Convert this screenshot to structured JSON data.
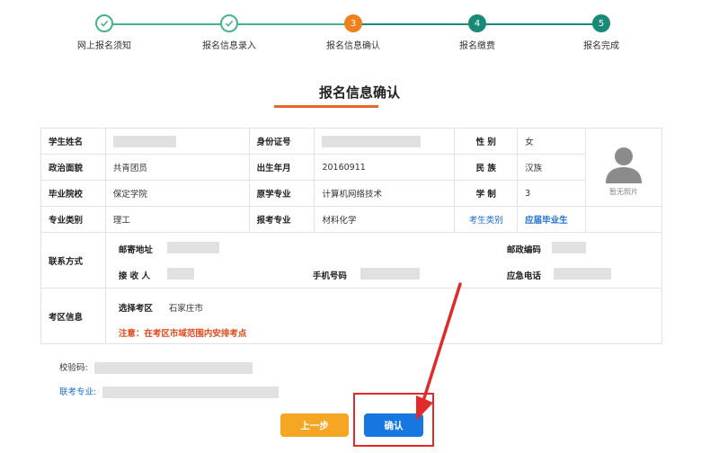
{
  "steps": [
    {
      "label": "网上报名须知",
      "state": "done",
      "number": ""
    },
    {
      "label": "报名信息录入",
      "state": "done",
      "number": ""
    },
    {
      "label": "报名信息确认",
      "state": "current",
      "number": "3"
    },
    {
      "label": "报名缴费",
      "state": "pending",
      "number": "4"
    },
    {
      "label": "报名完成",
      "state": "pending",
      "number": "5"
    }
  ],
  "colors": {
    "done": "#49b08f",
    "current": "#f0801e",
    "pending": "#1a8a78",
    "accent_underline": "#e8662a",
    "prev_button": "#f5a623",
    "confirm_button": "#1677e0",
    "annotation_red": "#e32a2a"
  },
  "page_title": "报名信息确认",
  "table": {
    "name_label": "学生姓名",
    "id_label": "身份证号",
    "gender_label": "性 别",
    "gender_value": "女",
    "political_label": "政治面貌",
    "political_value": "共青团员",
    "birth_label": "出生年月",
    "birth_value": "20160911",
    "ethnic_label": "民 族",
    "ethnic_value": "汉族",
    "school_label": "毕业院校",
    "school_value": "保定学院",
    "major_label": "原学专业",
    "major_value": "计算机网络技术",
    "length_label": "学 制",
    "length_value": "3",
    "category_label": "专业类别",
    "category_value": "理工",
    "apply_major_label": "报考专业",
    "apply_major_value": "材料化学",
    "student_type_label": "考生类别",
    "student_type_value": "应届毕业生",
    "photo_caption": "暂无照片",
    "contact_label": "联系方式",
    "address_label": "邮寄地址",
    "postal_label": "邮政编码",
    "receiver_label": "接 收 人",
    "phone_label": "手机号码",
    "emergency_label": "应急电话",
    "exam_label": "考区信息",
    "select_area_label": "选择考区",
    "select_area_value": "石家庄市",
    "note": "注意：在考区市域范围内安排考点"
  },
  "verify_code_label": "校验码:",
  "joint_major_label": "联考专业:",
  "buttons": {
    "prev": "上一步",
    "confirm": "确认"
  }
}
